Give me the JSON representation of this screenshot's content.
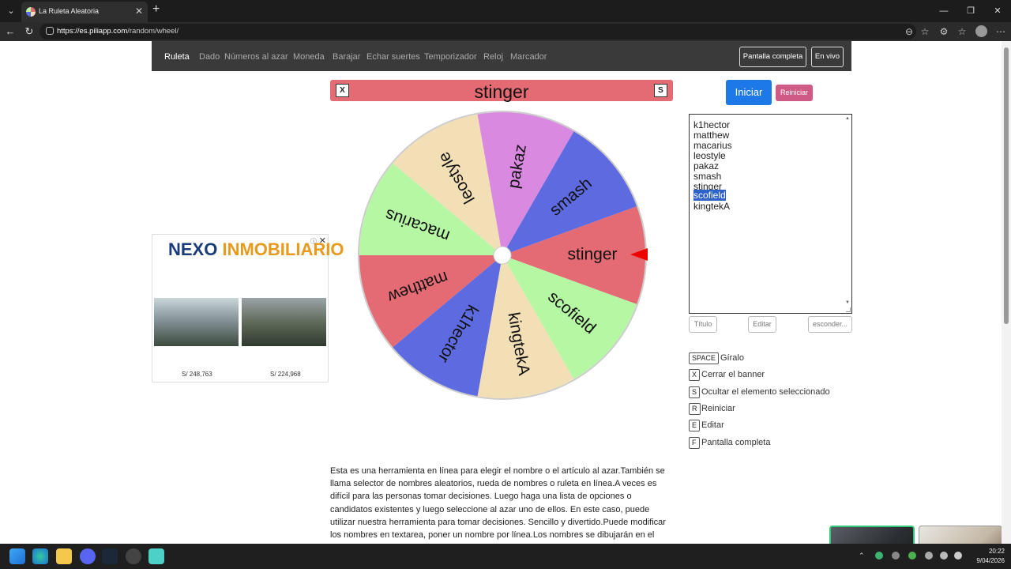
{
  "browser": {
    "tab_title": "La Ruleta Aleatoria",
    "url_host": "https://es.piliapp.com",
    "url_path": "/random/wheel/"
  },
  "navbar": {
    "items": [
      "Ruleta",
      "Dado",
      "Números al azar",
      "Moneda",
      "Barajar",
      "Echar suertes",
      "Temporizador",
      "Reloj",
      "Marcador"
    ],
    "active": "Ruleta",
    "fullscreen_label": "Pantalla completa",
    "live_label": "En vivo"
  },
  "result": {
    "close_key": "X",
    "hide_key": "S",
    "value": "stinger"
  },
  "wheel": {
    "segments": [
      {
        "label": "stinger",
        "color": "#e46a74"
      },
      {
        "label": "scofield",
        "color": "#b6f7a3"
      },
      {
        "label": "kingtekA",
        "color": "#f3dfb5"
      },
      {
        "label": "k1hector",
        "color": "#5e6ae0"
      },
      {
        "label": "matthew",
        "color": "#e46a74"
      },
      {
        "label": "macarius",
        "color": "#b6f7a3"
      },
      {
        "label": "leostyle",
        "color": "#f3dfb5"
      },
      {
        "label": "pakaz",
        "color": "#d98ae0"
      },
      {
        "label": "smash",
        "color": "#5e6ae0"
      }
    ]
  },
  "controls": {
    "start_label": "Iniciar",
    "reset_label": "Reiniciar",
    "names": [
      "k1hector",
      "matthew",
      "macarius",
      "leostyle",
      "pakaz",
      "smash",
      "stinger",
      "scofield",
      "kingtekA"
    ],
    "selected_name": "scofield",
    "title_label": "Título",
    "edit_label": "Editar",
    "hide_label": "esconder..."
  },
  "shortcuts": [
    {
      "key": "SPACE",
      "label": "Gíralo"
    },
    {
      "key": "X",
      "label": "Cerrar el banner"
    },
    {
      "key": "S",
      "label": "Ocultar el elemento seleccionado"
    },
    {
      "key": "R",
      "label": "Reiniciar"
    },
    {
      "key": "E",
      "label": "Editar"
    },
    {
      "key": "F",
      "label": "Pantalla completa"
    }
  ],
  "ad": {
    "logo_a": "NEXO",
    "logo_b": "INMOBILIARIO",
    "price1": "S/ 248,763",
    "price2": "S/ 224,968"
  },
  "description": "Esta es una herramienta en línea para elegir el nombre o el artículo al azar.También se llama selector de nombres aleatorios, rueda de nombres o ruleta en línea.A veces es difícil para las personas tomar decisiones. Luego haga una lista de opciones o candidatos existentes y luego seleccione al azar uno de ellos. En este caso, puede utilizar nuestra herramienta para tomar decisiones. Sencillo y divertido.Puede modificar los nombres en textarea, poner un nombre por línea.Los nombres se dibujarán en el círculo.Simplemente haga clic en la rueda",
  "taskbar": {
    "time": "20:22",
    "date": "9/04/2026"
  }
}
